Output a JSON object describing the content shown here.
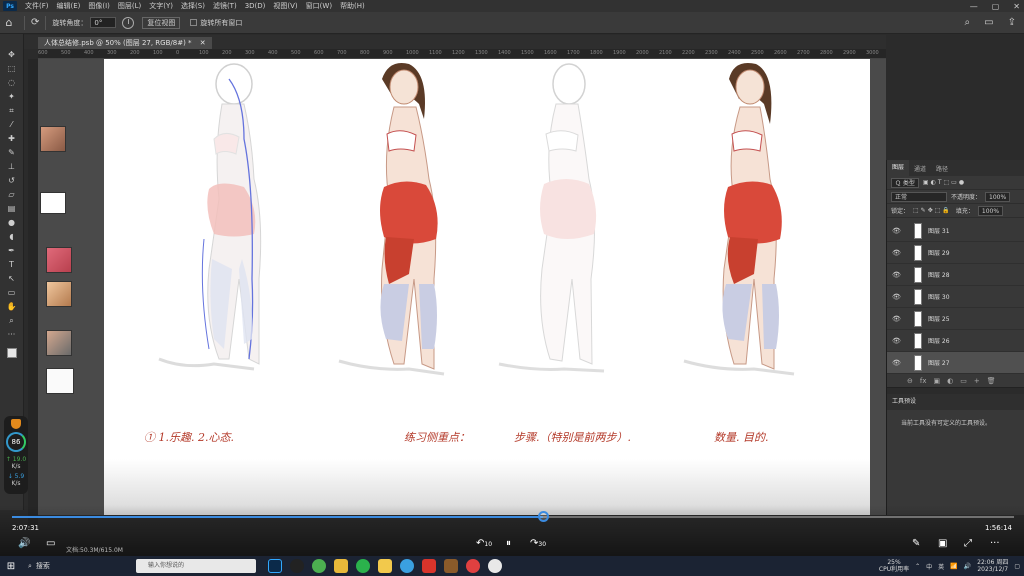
{
  "menubar": {
    "app_icon": "Ps",
    "items": [
      "文件(F)",
      "编辑(E)",
      "图像(I)",
      "图层(L)",
      "文字(Y)",
      "选择(S)",
      "滤镜(T)",
      "3D(D)",
      "视图(V)",
      "窗口(W)",
      "帮助(H)"
    ],
    "window_controls": [
      "—",
      "▢",
      "✕"
    ]
  },
  "options": {
    "rotate_label": "旋转角度：",
    "rotate_value": "0°",
    "reset_view": "复位视图",
    "rotate_all": "旋转所有窗口"
  },
  "document": {
    "tab_title": "人体总结修.psb @ 50% (图层 27, RGB/8#) *",
    "close": "✕"
  },
  "ruler_ticks": [
    "600",
    "500",
    "400",
    "300",
    "200",
    "100",
    "0",
    "100",
    "200",
    "300",
    "400",
    "500",
    "600",
    "700",
    "800",
    "900",
    "1000",
    "1100",
    "1200",
    "1300",
    "1400",
    "1500",
    "1600",
    "1700",
    "1800",
    "1900",
    "2000",
    "2100",
    "2200",
    "2300",
    "2400",
    "2500",
    "2600",
    "2700",
    "2800",
    "2900",
    "3000"
  ],
  "canvas_notes": [
    {
      "text": "① 1.乐趣.  2.心态.",
      "color": "#b43a2a"
    },
    {
      "text": "练习侧重点：",
      "color": "#b43a2a"
    },
    {
      "text": "步骤.（特别是前两步）.",
      "color": "#b43a2a"
    },
    {
      "text": "数量.  目的.",
      "color": "#b43a2a"
    }
  ],
  "layers_panel": {
    "tabs": [
      "图层",
      "通道",
      "路径"
    ],
    "filter_kind": "Ｑ 类型",
    "blend_mode": "正常",
    "opacity_label": "不透明度：",
    "opacity_value": "100%",
    "lock_label": "锁定：",
    "fill_label": "填充：",
    "fill_value": "100%",
    "layers": [
      {
        "name": "图层 31",
        "selected": false
      },
      {
        "name": "图层 29",
        "selected": false
      },
      {
        "name": "图层 28",
        "selected": false
      },
      {
        "name": "图层 30",
        "selected": false
      },
      {
        "name": "图层 25",
        "selected": false
      },
      {
        "name": "图层 26",
        "selected": false
      },
      {
        "name": "图层 27",
        "selected": true
      }
    ],
    "footer_icons": [
      "⊖",
      "fx",
      "▣",
      "◐",
      "▭",
      "+",
      "🗑"
    ]
  },
  "tool_presets": {
    "title": "工具预设",
    "message": "当前工具没有可定义的工具预设。"
  },
  "gauge": {
    "percent": "86",
    "up_speed": "↑ 19.0",
    "up_unit": "K/s",
    "down_speed": "↓ 5.9",
    "down_unit": "K/s"
  },
  "video": {
    "current_time": "2:07:31",
    "total_time": "1:56:14",
    "progress": 0.53,
    "skip_back": "10",
    "skip_fwd": "30",
    "status_text": "文档:50.3M/615.0M"
  },
  "taskbar": {
    "search_label": "搜索",
    "input_placeholder": "输入你想说的",
    "cpu_pct": "25%",
    "cpu_label": "CPU利用率",
    "ime_1": "中",
    "ime_2": "英",
    "time": "22:06 周四",
    "date": "2023/12/7"
  }
}
